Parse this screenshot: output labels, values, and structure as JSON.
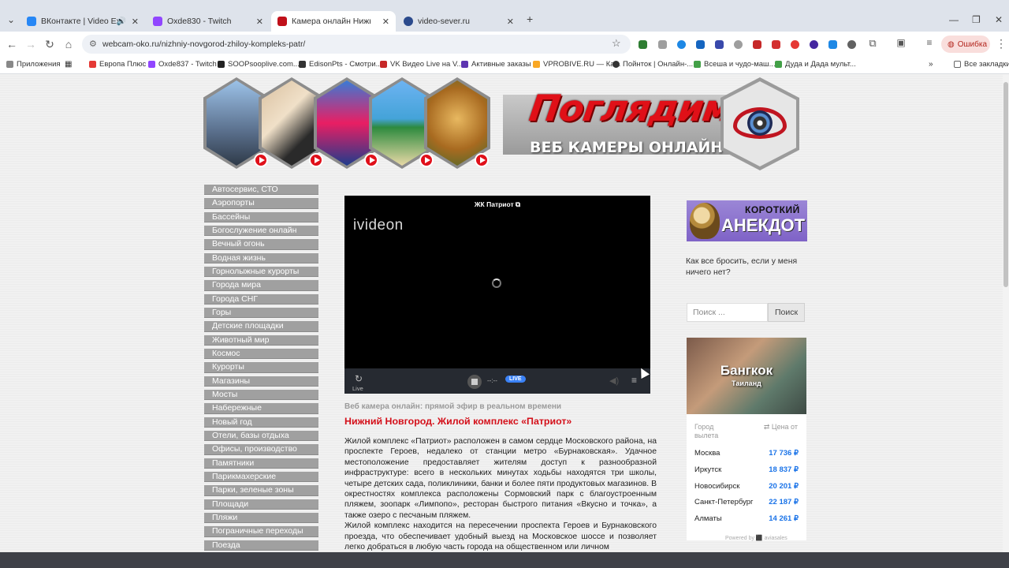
{
  "browser": {
    "tabs": [
      {
        "label": "ВКонтакте | Video Ext",
        "color": "#2787f5",
        "active": false
      },
      {
        "label": "Oxde830 - Twitch",
        "color": "#9146ff",
        "active": false
      },
      {
        "label": "Камера онлайн Нижний Новг",
        "color": "#c0101a",
        "active": true
      },
      {
        "label": "video-sever.ru",
        "color": "#2b4a8c",
        "active": false
      }
    ],
    "new_tab": "+",
    "url": "webcam-oko.ru/nizhniy-novgorod-zhiloy-kompleks-patr/",
    "error_label": "Ошибка",
    "bookmarks": [
      {
        "label": "Приложения",
        "color": "#888"
      },
      {
        "label": "Европа Плюс",
        "color": "#e53935"
      },
      {
        "label": "Oxde837 - Twitch",
        "color": "#9146ff"
      },
      {
        "label": "SOOPsooplive.com...",
        "color": "#222"
      },
      {
        "label": "EdisonPts - Смотри...",
        "color": "#333"
      },
      {
        "label": "VK Видео Live на V...",
        "color": "#c62828"
      },
      {
        "label": "Активные заказы",
        "color": "#5e35b1"
      },
      {
        "label": "VPROBIVE.RU — Ка...",
        "color": "#f9a825"
      },
      {
        "label": "Пойнток | Онлайн-...",
        "color": "#333"
      },
      {
        "label": "Всеша и чудо-маш...",
        "color": "#43a047"
      },
      {
        "label": "Дуда и Дада мульт...",
        "color": "#43a047"
      },
      {
        "label": "Все закладки",
        "color": "#666"
      }
    ]
  },
  "site": {
    "brand": "Поглядим!",
    "brand_sub": "ВЕБ КАМЕРЫ ОНЛАЙН",
    "menu": [
      "Автосервис, СТО",
      "Аэропорты",
      "Бассейны",
      "Богослужение онлайн",
      "Вечный огонь",
      "Водная жизнь",
      "Горнолыжные курорты",
      "Города мира",
      "Города СНГ",
      "Горы",
      "Детские площадки",
      "Животный мир",
      "Космос",
      "Курорты",
      "Магазины",
      "Мосты",
      "Набережные",
      "Новый год",
      "Отели, базы отдыха",
      "Офисы, производство",
      "Памятники",
      "Парикмахерские",
      "Парки, зеленые зоны",
      "Площади",
      "Пляжи",
      "Пограничные переходы",
      "Поезда"
    ],
    "player": {
      "title": "ЖК Патриот",
      "logo": "ivideon",
      "live_label": "Live",
      "time": "--:--",
      "live_badge": "LIVE"
    },
    "article": {
      "subtitle": "Веб камера онлайн: прямой эфир в реальном времени",
      "heading": "Нижний Новгород. Жилой комплекс «Патриот»",
      "p1": "Жилой комплекс «Патриот» расположен в самом сердце Московского района, на проспекте Героев, недалеко от станции метро «Бурнаковская». Удачное местоположение предоставляет жителям доступ к разнообразной инфраструктуре: всего в нескольких минутах ходьбы находятся три школы, четыре детских сада, поликлиники, банки и более пяти продуктовых магазинов. В окрестностях комплекса расположены Сормовский парк с благоустроенным пляжем, зоопарк «Лимпопо», ресторан быстрого питания «Вкусно и точка», а также озеро с песчаным пляжем.",
      "p2": "Жилой комплекс находится на пересечении проспекта Героев и Бурнаковского проезда, что обеспечивает удобный выезд на Московское шоссе и позволяет легко добраться в любую часть города на общественном или личном"
    },
    "sidebar": {
      "anek_top": "КОРОТКИЙ",
      "anek_main": "АНЕКДОТ",
      "joke": "Как все бросить, если у меня ничего нет?",
      "search_placeholder": "Поиск ...",
      "search_button": "Поиск",
      "city": "Бангкок",
      "country": "Таиланд",
      "col_city": "Город вылета",
      "col_price": "⇄ Цена от",
      "fares": [
        {
          "city": "Москва",
          "price": "17 736 ₽"
        },
        {
          "city": "Иркутск",
          "price": "18 837 ₽"
        },
        {
          "city": "Новосибирск",
          "price": "20 201 ₽"
        },
        {
          "city": "Санкт-Петербург",
          "price": "22 187 ₽"
        },
        {
          "city": "Алматы",
          "price": "14 261 ₽"
        }
      ],
      "powered": "Powered by ⬛ aviasales"
    }
  }
}
